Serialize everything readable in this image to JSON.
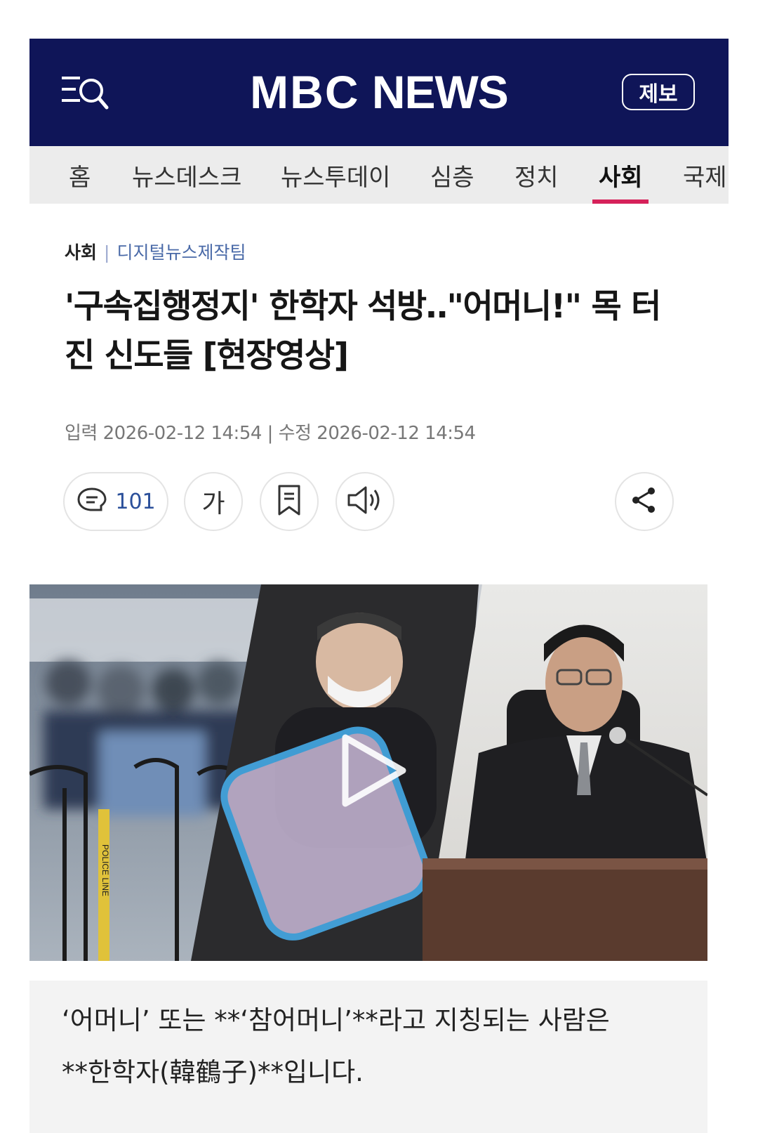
{
  "header": {
    "logo_left": "MBC",
    "logo_right": "NEWS",
    "report_label": "제보",
    "menu_icon": "menu-search-icon"
  },
  "nav": {
    "items": [
      "홈",
      "뉴스데스크",
      "뉴스투데이",
      "심층",
      "정치",
      "사회",
      "국제"
    ],
    "active": "사회",
    "accent": "#d6215a"
  },
  "article": {
    "category": "사회",
    "team": "디지털뉴스제작팀",
    "headline": "'구속집행정지' 한학자 석방‥\"어머니!\" 목 터진 신도들 [현장영상]",
    "dates": "입력 2026-02-12 14:54 | 수정 2026-02-12 14:54"
  },
  "tools": {
    "comment_count": "101",
    "font_label": "가",
    "icons": [
      "comment-icon",
      "font-size-icon",
      "bookmark-icon",
      "audio-icon",
      "share-icon"
    ]
  },
  "video": {
    "play_icon": "play-icon",
    "barrier_text": "POLICE LINE"
  },
  "caption": {
    "line1": "‘어머니’ 또는 **‘참어머니’**라고 지칭되는 사람은",
    "line2": "**한학자(韓鶴子)**입니다."
  },
  "colors": {
    "header_bg": "#0f1558",
    "nav_bg": "#ececec",
    "team_link": "#4a6aa8"
  }
}
